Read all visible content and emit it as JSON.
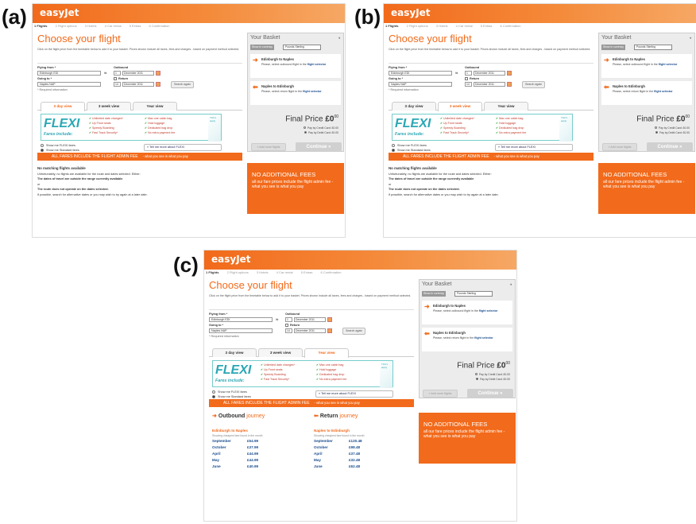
{
  "labels": {
    "a": "(a)",
    "b": "(b)",
    "c": "(c)"
  },
  "site": {
    "logo": "easyJet",
    "steps": [
      "1 Flights",
      "2 Flight options",
      "3 Hotels",
      "4 Car rental",
      "5 Extras",
      "6 Confirmation"
    ],
    "title": "Choose your flight",
    "intro": "Click on the flight price from the timetable below to add it to your basket. Prices shown include all taxes, fees and charges - based on payment method selected."
  },
  "form": {
    "flying_from_label": "Flying from *",
    "flying_from_value": "Edinburgh EDI",
    "going_to_label": "Going to *",
    "going_to_value": "Naples NAP",
    "outbound_label": "Outbound",
    "outbound_day": "1",
    "outbound_month": "December 2011",
    "return_label": "Return",
    "return_day": "14",
    "return_month": "December 2011",
    "required": "* Required information",
    "search_button": "Search again"
  },
  "tabs": [
    "3 day view",
    "3 week view",
    "Year view"
  ],
  "flexi": {
    "title": "FLEXI",
    "subtitle": "Fares include:",
    "features_left": [
      "Unlimited date changes*",
      "Up Front seats",
      "Speedy Boarding",
      "Fast Track Security*"
    ],
    "features_right": [
      "Max one cabin bag",
      "Hold luggage",
      "Dedicated bag drop",
      "No extra payment fee"
    ],
    "corner": "T&C's apply"
  },
  "fare_toggle": {
    "flexi_option": "Show me FLEXI fares",
    "standard_option": "Show me Standard fares",
    "tell_me": "» Tell me more about FLEXI"
  },
  "fees_bar": {
    "main": "ALL FARES INCLUDE THE FLIGHT ADMIN FEE",
    "sub": "- what you see is what you pay"
  },
  "no_match": {
    "heading": "No matching flights available",
    "line1": "Unfortunately, no flights are available for the route and dates selected. Either:",
    "line2": "The dates of travel are outside the range currently available",
    "or": "or",
    "line3": "The route does not operate on the dates selected.",
    "line4": "If possible, search for alternative dates or you may wish to try again at a later date."
  },
  "basket": {
    "title": "Your Basket",
    "collapse": "◂",
    "currency_label": "Show in currency",
    "currency_value": "Pounds Sterling",
    "outbound_route": "Edinburgh to Naples",
    "outbound_note": "Please, select outbound flight in the",
    "outbound_link": "flight selector",
    "return_route": "Naples to Edinburgh",
    "return_note": "Please, select return flight in the",
    "return_link": "flight selector",
    "final_label": "Final Price",
    "final_value": "£0",
    "final_pence": "00",
    "pay_credit": "Pay by Credit Card: £0.00",
    "pay_debit": "Pay by Debit Card: £0.00",
    "add_button": "« Add more flights",
    "continue_button": "Continue »"
  },
  "promo": {
    "heading": "NO ADDITIONAL FEES",
    "text": "all our fare prices include the flight admin fee - what you see is what you pay"
  },
  "year_view": {
    "outbound_heading": "Outbound",
    "outbound_heading_light": "journey",
    "return_heading": "Return",
    "return_heading_light": "journey",
    "outbound_route": "Edinburgh to Naples",
    "return_route": "Naples to Edinburgh",
    "note": "Showing cheapest fare found in the month",
    "outbound_prices": [
      {
        "month": "September",
        "price": "£54.99"
      },
      {
        "month": "October",
        "price": "£37.99"
      },
      {
        "month": "April",
        "price": "£44.99"
      },
      {
        "month": "May",
        "price": "£44.99"
      },
      {
        "month": "June",
        "price": "£40.99"
      }
    ],
    "return_prices": [
      {
        "month": "September",
        "price": "£120.48"
      },
      {
        "month": "October",
        "price": "£98.48"
      },
      {
        "month": "April",
        "price": "£37.48"
      },
      {
        "month": "May",
        "price": "£32.48"
      },
      {
        "month": "June",
        "price": "£62.48"
      }
    ]
  }
}
